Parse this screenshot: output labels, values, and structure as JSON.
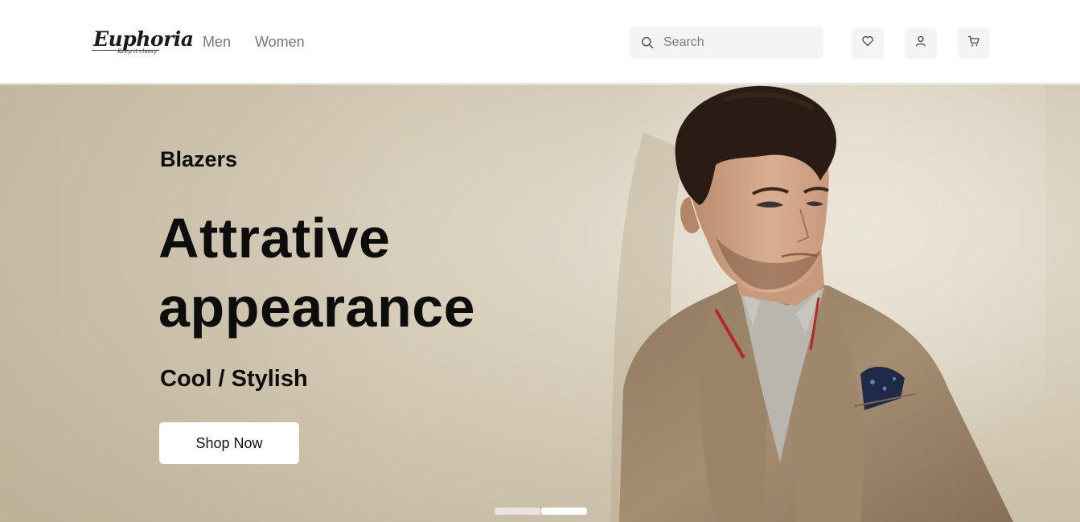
{
  "header": {
    "logo": {
      "name": "Euphoria",
      "tagline": "Keep it classy"
    },
    "nav": [
      {
        "label": "Men"
      },
      {
        "label": "Women"
      }
    ],
    "search": {
      "placeholder": "Search",
      "value": ""
    },
    "icons": [
      "heart-icon",
      "user-icon",
      "cart-icon"
    ]
  },
  "hero": {
    "category": "Blazers",
    "headline_line1": "Attrative",
    "headline_line2": "appearance",
    "subline": "Cool / Stylish",
    "cta_label": "Shop Now",
    "slider": {
      "count": 2,
      "active_index": 1
    },
    "image": "man-in-tan-blazer"
  },
  "colors": {
    "hero_background": "#d8cfbd",
    "text": "#0d0d0d",
    "nav_text": "#777777",
    "icon_button_bg": "#f4f4f4"
  }
}
